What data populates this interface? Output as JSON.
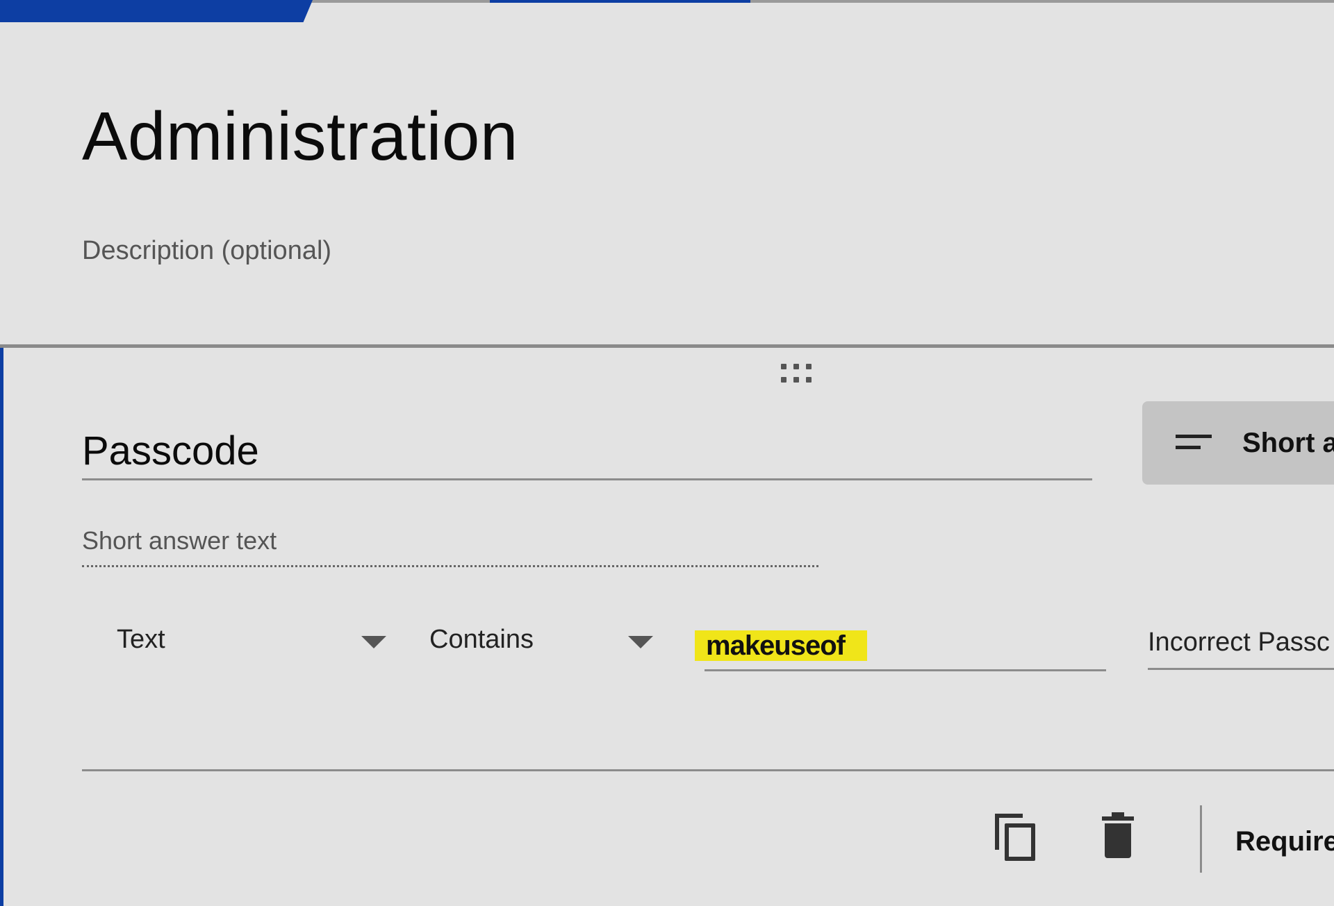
{
  "form": {
    "title": "Administration",
    "description_placeholder": "Description (optional)"
  },
  "question": {
    "title": "Passcode",
    "type_selector": {
      "label": "Short a",
      "icon": "short-answer-icon"
    },
    "answer_placeholder": "Short answer text",
    "validation": {
      "type": "Text",
      "condition": "Contains",
      "value": "makeuseof",
      "error_text": "Incorrect Passc"
    },
    "footer": {
      "duplicate_icon": "copy-icon",
      "delete_icon": "trash-icon",
      "required_label": "Require"
    }
  },
  "colors": {
    "accent": "#0d3ea3",
    "background": "#e3e3e3",
    "highlight": "#f0e519",
    "type_selector_bg": "#c4c4c4"
  }
}
